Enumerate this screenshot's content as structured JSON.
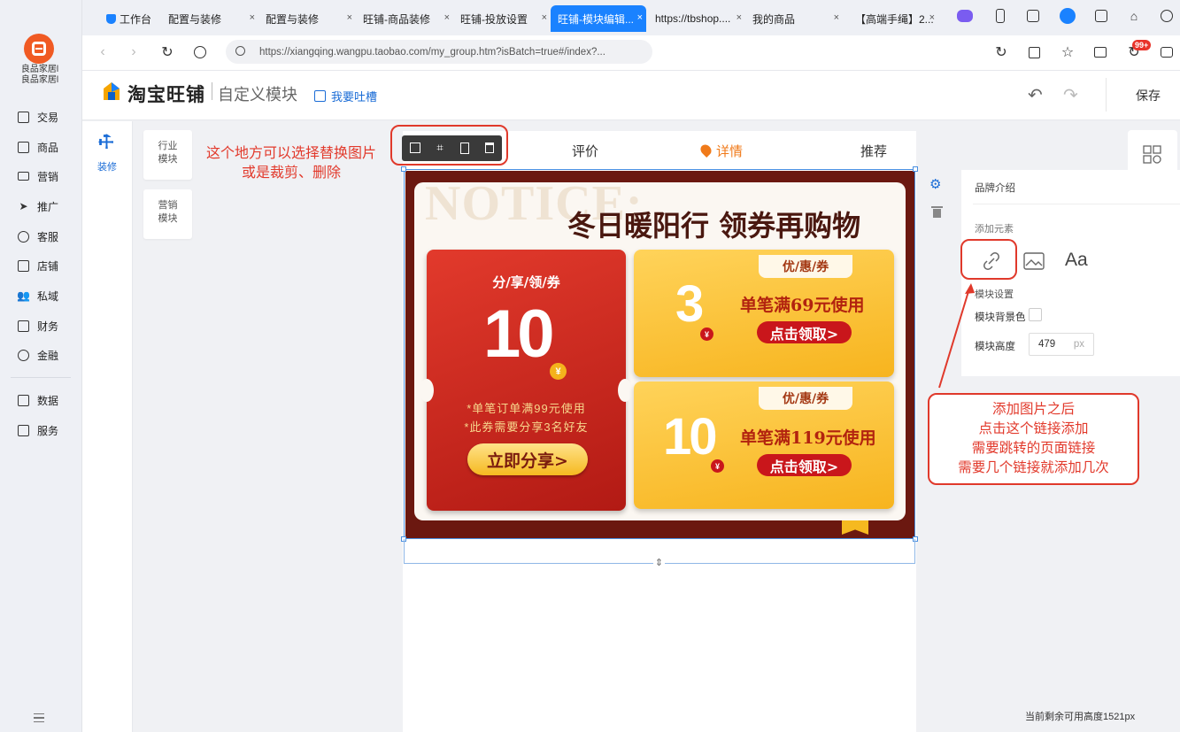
{
  "sidebar": {
    "shop_name": "良品家居l\n良品家居l",
    "items": [
      {
        "label": "交易",
        "icon": "trade-icon"
      },
      {
        "label": "商品",
        "icon": "goods-icon"
      },
      {
        "label": "营销",
        "icon": "marketing-icon"
      },
      {
        "label": "推广",
        "icon": "promotion-icon"
      },
      {
        "label": "客服",
        "icon": "service-icon"
      },
      {
        "label": "店铺",
        "icon": "shop-icon"
      },
      {
        "label": "私域",
        "icon": "private-domain-icon"
      },
      {
        "label": "财务",
        "icon": "finance-icon"
      },
      {
        "label": "金融",
        "icon": "fintech-icon"
      },
      {
        "label": "数据",
        "icon": "data-icon"
      },
      {
        "label": "服务",
        "icon": "services-icon"
      }
    ]
  },
  "tabs": [
    {
      "label": "工作台",
      "active": false
    },
    {
      "label": "配置与装修",
      "active": false
    },
    {
      "label": "配置与装修",
      "active": false
    },
    {
      "label": "旺铺-商品装修",
      "active": false
    },
    {
      "label": "旺铺-投放设置",
      "active": false
    },
    {
      "label": "旺铺-模块编辑...",
      "active": true
    },
    {
      "label": "https://tbshop....",
      "active": false
    },
    {
      "label": "我的商品",
      "active": false
    },
    {
      "label": "【高端手绳】2...",
      "active": false
    }
  ],
  "tab_close": "×",
  "notification_badge": "99+",
  "address": {
    "url": "https://xiangqing.wangpu.taobao.com/my_group.htm?isBatch=true#/index?..."
  },
  "header": {
    "brand": "淘宝旺铺",
    "subtitle": "自定义模块",
    "feedback": "我要吐槽",
    "save": "保存"
  },
  "decorate": {
    "label": "装修"
  },
  "modules": [
    {
      "label": "行业\n模块"
    },
    {
      "label": "营销\n模块"
    }
  ],
  "shop_nav": {
    "tabs": [
      "评价",
      "详情",
      "推荐"
    ],
    "active_tab": "详情"
  },
  "banner": {
    "watermark": "NOTICE:",
    "title": "冬日暖阳行 领券再购物",
    "big_coupon": {
      "head": "分/享/领/券",
      "amount": "10",
      "currency": "¥",
      "note1": "*单笔订单满99元使用",
      "note2": "*此券需要分享3名好友",
      "button": "立即分享>"
    },
    "coupons": [
      {
        "tag": "优/惠/券",
        "amount": "3",
        "condition": "单笔满69元使用",
        "button": "点击领取>"
      },
      {
        "tag": "优/惠/券",
        "amount": "10",
        "condition": "单笔满119元使用",
        "button": "点击领取>"
      }
    ]
  },
  "annotations": {
    "toolbar_note": "这个地方可以选择替换图片\n或是裁剪、删除",
    "link_note": "添加图片之后\n点击这个链接添加\n需要跳转的页面链接\n需要几个链接就添加几次"
  },
  "panel": {
    "title": "品牌介绍",
    "add_element": "添加元素",
    "text_element": "Aa",
    "settings": "模块设置",
    "bg_color_label": "模块背景色",
    "height_label": "模块高度",
    "height_value": "479",
    "height_unit": "px"
  },
  "footer": {
    "remaining": "当前剩余可用高度1521px"
  },
  "colors": {
    "accent": "#1a82ff",
    "annotation": "#e23a2c",
    "coupon_red": "#c9161b",
    "coupon_gold": "#f7b41e"
  }
}
